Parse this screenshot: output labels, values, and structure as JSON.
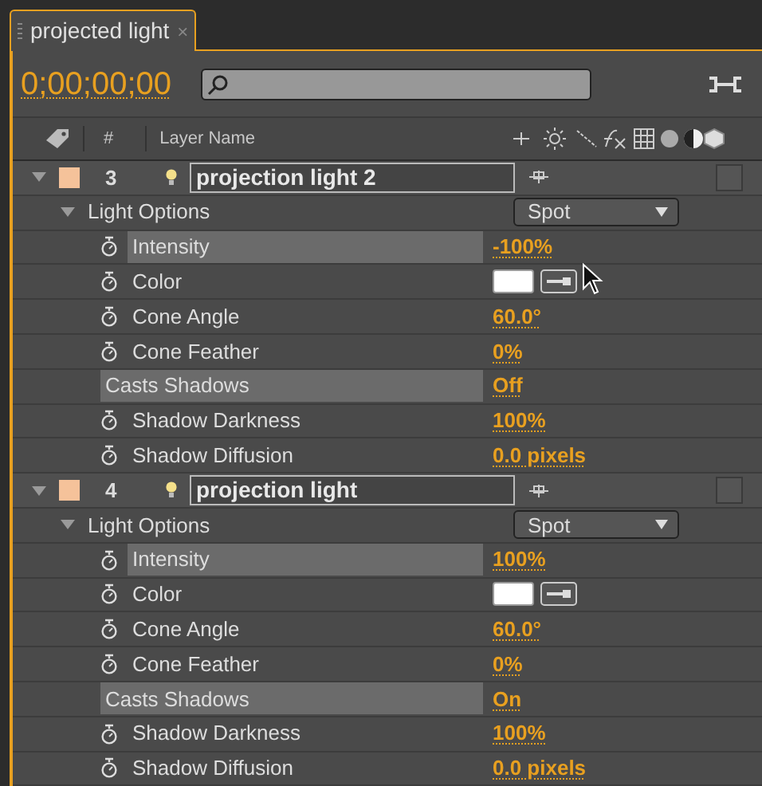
{
  "tab": {
    "title": "projected light",
    "close": "×",
    "selected": true
  },
  "timecode": "0;00;00;00",
  "header": {
    "number": "#",
    "layer_name": "Layer Name"
  },
  "layers": [
    {
      "number": "3",
      "name": "projection light 2",
      "color": "#f5c29a",
      "expanded": true,
      "group": {
        "label": "Light Options",
        "expanded": true,
        "type": "Spot",
        "properties": [
          {
            "kind": "value",
            "name": "Intensity",
            "value": "-100%",
            "stopwatch": true,
            "selected": true
          },
          {
            "kind": "color",
            "name": "Color",
            "color": "#ffffff",
            "stopwatch": true,
            "selected": false
          },
          {
            "kind": "value",
            "name": "Cone Angle",
            "value": "60.0°",
            "stopwatch": true,
            "selected": false
          },
          {
            "kind": "value",
            "name": "Cone Feather",
            "value": "0%",
            "stopwatch": true,
            "selected": false
          },
          {
            "kind": "value",
            "name": "Casts Shadows",
            "value": "Off",
            "stopwatch": false,
            "selected": true
          },
          {
            "kind": "value",
            "name": "Shadow Darkness",
            "value": "100%",
            "stopwatch": true,
            "selected": false
          },
          {
            "kind": "value",
            "name": "Shadow Diffusion",
            "value": "0.0 pixels",
            "stopwatch": true,
            "selected": false
          }
        ]
      }
    },
    {
      "number": "4",
      "name": "projection light",
      "color": "#f5c29a",
      "expanded": true,
      "group": {
        "label": "Light Options",
        "expanded": true,
        "type": "Spot",
        "properties": [
          {
            "kind": "value",
            "name": "Intensity",
            "value": "100%",
            "stopwatch": true,
            "selected": true
          },
          {
            "kind": "color",
            "name": "Color",
            "color": "#ffffff",
            "stopwatch": true,
            "selected": false
          },
          {
            "kind": "value",
            "name": "Cone Angle",
            "value": "60.0°",
            "stopwatch": true,
            "selected": false
          },
          {
            "kind": "value",
            "name": "Cone Feather",
            "value": "0%",
            "stopwatch": true,
            "selected": false
          },
          {
            "kind": "value",
            "name": "Casts Shadows",
            "value": "On",
            "stopwatch": false,
            "selected": true
          },
          {
            "kind": "value",
            "name": "Shadow Darkness",
            "value": "100%",
            "stopwatch": true,
            "selected": false
          },
          {
            "kind": "value",
            "name": "Shadow Diffusion",
            "value": "0.0 pixels",
            "stopwatch": true,
            "selected": false
          }
        ]
      }
    }
  ]
}
